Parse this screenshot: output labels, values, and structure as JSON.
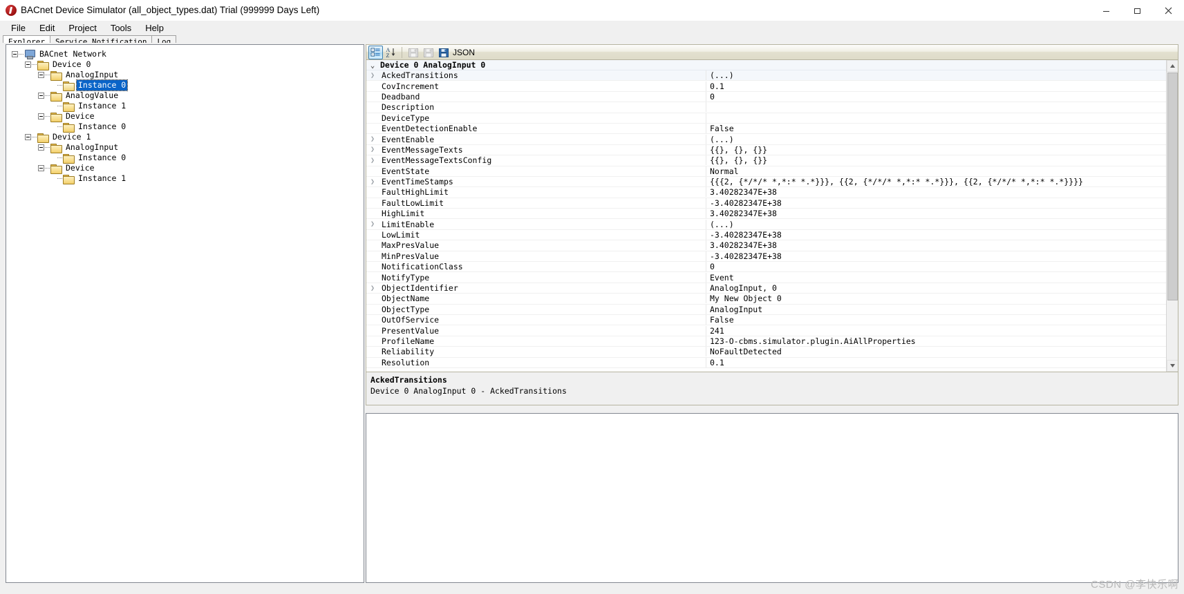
{
  "window": {
    "title": "BACnet Device Simulator (all_object_types.dat) Trial (999999 Days Left)",
    "app_icon": "bacnet-app-icon",
    "minimize": "minimize-icon",
    "maximize": "maximize-icon",
    "close": "close-icon"
  },
  "menu": {
    "items": [
      {
        "label": "File"
      },
      {
        "label": "Edit"
      },
      {
        "label": "Project"
      },
      {
        "label": "Tools"
      },
      {
        "label": "Help"
      }
    ]
  },
  "tabs": [
    {
      "label": "Explorer",
      "active": true
    },
    {
      "label": "Service Notification",
      "active": false
    },
    {
      "label": "Log",
      "active": false
    }
  ],
  "tree": {
    "nodes": [
      {
        "label": "BACnet Network",
        "depth": 0,
        "icon": "computer-icon",
        "expander": "minus",
        "selected": false
      },
      {
        "label": "Device 0",
        "depth": 1,
        "icon": "folder-icon",
        "expander": "minus",
        "selected": false
      },
      {
        "label": "AnalogInput",
        "depth": 2,
        "icon": "folder-icon",
        "expander": "minus",
        "selected": false
      },
      {
        "label": "Instance 0",
        "depth": 3,
        "icon": "folder-open-icon",
        "expander": "none",
        "selected": true
      },
      {
        "label": "AnalogValue",
        "depth": 2,
        "icon": "folder-icon",
        "expander": "minus",
        "selected": false
      },
      {
        "label": "Instance 1",
        "depth": 3,
        "icon": "folder-icon",
        "expander": "none",
        "selected": false
      },
      {
        "label": "Device",
        "depth": 2,
        "icon": "folder-icon",
        "expander": "minus",
        "selected": false
      },
      {
        "label": "Instance 0",
        "depth": 3,
        "icon": "folder-icon",
        "expander": "none",
        "selected": false
      },
      {
        "label": "Device 1",
        "depth": 1,
        "icon": "folder-icon",
        "expander": "minus",
        "selected": false
      },
      {
        "label": "AnalogInput",
        "depth": 2,
        "icon": "folder-icon",
        "expander": "minus",
        "selected": false
      },
      {
        "label": "Instance 0",
        "depth": 3,
        "icon": "folder-icon",
        "expander": "none",
        "selected": false
      },
      {
        "label": "Device",
        "depth": 2,
        "icon": "folder-icon",
        "expander": "minus",
        "selected": false
      },
      {
        "label": "Instance 1",
        "depth": 3,
        "icon": "folder-icon",
        "expander": "none",
        "selected": false
      }
    ]
  },
  "property_toolbar": {
    "categorized_icon": "categorized-view-icon",
    "alphabetical_icon": "alphabetical-sort-icon",
    "save_icon": "save-disabled-icon",
    "save_as_icon": "save-as-disabled-icon",
    "json_icon": "save-json-icon",
    "json_label": "JSON"
  },
  "property_grid": {
    "category": "Device 0 AnalogInput 0",
    "rows": [
      {
        "name": "AckedTransitions",
        "value": "(...)",
        "expandable": true,
        "selected": true
      },
      {
        "name": "CovIncrement",
        "value": "0.1",
        "expandable": false,
        "selected": false
      },
      {
        "name": "Deadband",
        "value": "0",
        "expandable": false,
        "selected": false
      },
      {
        "name": "Description",
        "value": "",
        "expandable": false,
        "selected": false
      },
      {
        "name": "DeviceType",
        "value": "",
        "expandable": false,
        "selected": false
      },
      {
        "name": "EventDetectionEnable",
        "value": "False",
        "expandable": false,
        "selected": false
      },
      {
        "name": "EventEnable",
        "value": "(...)",
        "expandable": true,
        "selected": false
      },
      {
        "name": "EventMessageTexts",
        "value": "{{}, {}, {}}",
        "expandable": true,
        "selected": false
      },
      {
        "name": "EventMessageTextsConfig",
        "value": "{{}, {}, {}}",
        "expandable": true,
        "selected": false
      },
      {
        "name": "EventState",
        "value": "Normal",
        "expandable": false,
        "selected": false
      },
      {
        "name": "EventTimeStamps",
        "value": "{{{2, {*/*/* *,*:* *.*}}}, {{2, {*/*/* *,*:* *.*}}}, {{2, {*/*/* *,*:* *.*}}}}",
        "expandable": true,
        "selected": false
      },
      {
        "name": "FaultHighLimit",
        "value": "3.40282347E+38",
        "expandable": false,
        "selected": false
      },
      {
        "name": "FaultLowLimit",
        "value": "-3.40282347E+38",
        "expandable": false,
        "selected": false
      },
      {
        "name": "HighLimit",
        "value": "3.40282347E+38",
        "expandable": false,
        "selected": false
      },
      {
        "name": "LimitEnable",
        "value": "(...)",
        "expandable": true,
        "selected": false
      },
      {
        "name": "LowLimit",
        "value": "-3.40282347E+38",
        "expandable": false,
        "selected": false
      },
      {
        "name": "MaxPresValue",
        "value": "3.40282347E+38",
        "expandable": false,
        "selected": false
      },
      {
        "name": "MinPresValue",
        "value": "-3.40282347E+38",
        "expandable": false,
        "selected": false
      },
      {
        "name": "NotificationClass",
        "value": "0",
        "expandable": false,
        "selected": false
      },
      {
        "name": "NotifyType",
        "value": "Event",
        "expandable": false,
        "selected": false
      },
      {
        "name": "ObjectIdentifier",
        "value": "AnalogInput, 0",
        "expandable": true,
        "selected": false
      },
      {
        "name": "ObjectName",
        "value": "My New Object 0",
        "expandable": false,
        "selected": false
      },
      {
        "name": "ObjectType",
        "value": "AnalogInput",
        "expandable": false,
        "selected": false
      },
      {
        "name": "OutOfService",
        "value": "False",
        "expandable": false,
        "selected": false
      },
      {
        "name": "PresentValue",
        "value": "241",
        "expandable": false,
        "selected": false
      },
      {
        "name": "ProfileName",
        "value": "123-O-cbms.simulator.plugin.AiAllProperties",
        "expandable": false,
        "selected": false
      },
      {
        "name": "Reliability",
        "value": "NoFaultDetected",
        "expandable": false,
        "selected": false
      },
      {
        "name": "Resolution",
        "value": "0.1",
        "expandable": false,
        "selected": false
      }
    ]
  },
  "description_pane": {
    "title": "AckedTransitions",
    "text": "Device 0 AnalogInput 0 - AckedTransitions"
  },
  "output": {
    "text": ""
  },
  "watermark": "CSDN @李快乐啊"
}
